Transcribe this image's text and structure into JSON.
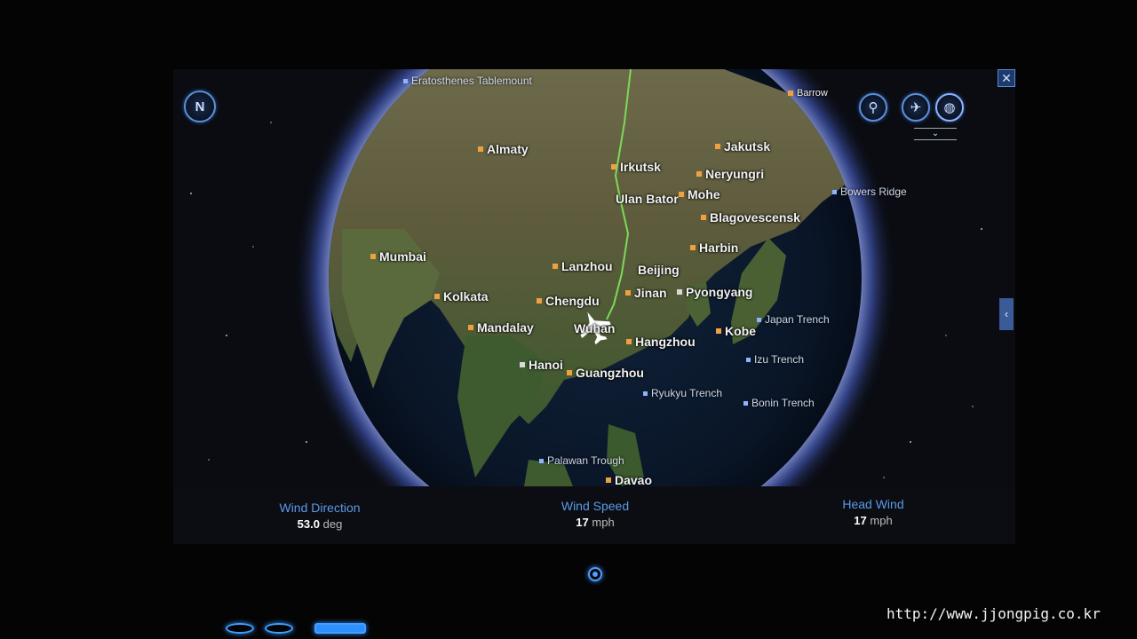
{
  "map": {
    "cities": [
      {
        "name": "Almaty"
      },
      {
        "name": "Irkutsk"
      },
      {
        "name": "Jakutsk"
      },
      {
        "name": "Neryungri"
      },
      {
        "name": "Ulan Bator"
      },
      {
        "name": "Mohe"
      },
      {
        "name": "Blagovescensk"
      },
      {
        "name": "Harbin"
      },
      {
        "name": "Mumbai"
      },
      {
        "name": "Lanzhou"
      },
      {
        "name": "Beijing"
      },
      {
        "name": "Kolkata"
      },
      {
        "name": "Chengdu"
      },
      {
        "name": "Jinan"
      },
      {
        "name": "Pyongyang"
      },
      {
        "name": "Mandalay"
      },
      {
        "name": "Wuhan"
      },
      {
        "name": "Hangzhou"
      },
      {
        "name": "Kobe"
      },
      {
        "name": "Hanoi"
      },
      {
        "name": "Guangzhou"
      },
      {
        "name": "Davao"
      },
      {
        "name": "Barrow"
      }
    ],
    "features": [
      {
        "name": "Eratosthenes Tablemount"
      },
      {
        "name": "Bowers Ridge"
      },
      {
        "name": "Japan Trench"
      },
      {
        "name": "Izu Trench"
      },
      {
        "name": "Ryukyu Trench"
      },
      {
        "name": "Bonin Trench"
      },
      {
        "name": "Palawan Trough"
      }
    ],
    "route_color": "#7ed957",
    "city_marker_color": "#f0a040",
    "feature_marker_color": "#8fb4ff"
  },
  "controls": {
    "compass_label": "N",
    "close_label": "✕",
    "side_tab_label": "‹",
    "expand_label": "⌄"
  },
  "info": {
    "wind_direction_label": "Wind Direction",
    "wind_direction_value": "53.0",
    "wind_direction_unit": "deg",
    "wind_speed_label": "Wind Speed",
    "wind_speed_value": "17",
    "wind_speed_unit": "mph",
    "head_wind_label": "Head Wind",
    "head_wind_value": "17",
    "head_wind_unit": "mph"
  },
  "watermark": "http://www.jjongpig.co.kr",
  "colors": {
    "accent": "#5a9ae8",
    "globe_glow": "#8fb0ff"
  }
}
